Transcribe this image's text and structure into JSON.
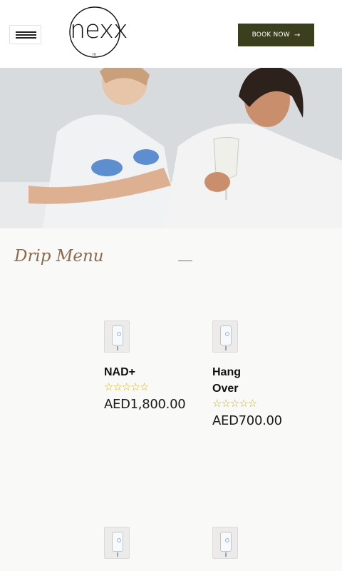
{
  "header": {
    "logo_text": "nexx",
    "logo_sub": "IV",
    "book_label": "BOOK NOW",
    "book_arrow": "→"
  },
  "hero": {
    "alt": ""
  },
  "section": {
    "title": "Drip Menu"
  },
  "products": [
    {
      "name": "NAD+",
      "stars": "☆☆☆☆☆",
      "price": "AED1,800.00"
    },
    {
      "name_line1": "Hang",
      "name_line2": "Over",
      "stars": "☆☆☆☆☆",
      "price": "AED700.00"
    }
  ],
  "icons": {
    "menu": "hamburger-icon",
    "arrow": "arrow-right-icon",
    "star": "star-outline-icon"
  },
  "colors": {
    "accent_brown": "#8a6b4f",
    "button_olive": "#3b3f1e",
    "star_gold": "#d6b11a"
  }
}
